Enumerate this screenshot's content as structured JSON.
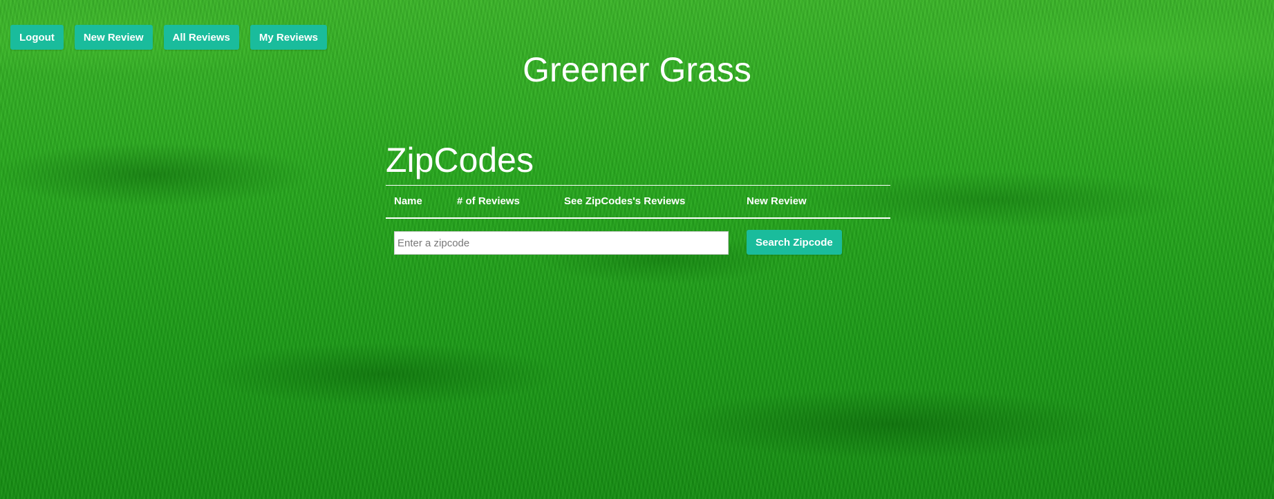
{
  "nav": {
    "items": [
      {
        "label": "Logout"
      },
      {
        "label": "New Review"
      },
      {
        "label": "All Reviews"
      },
      {
        "label": "My Reviews"
      }
    ]
  },
  "header": {
    "title": "Greener Grass"
  },
  "main": {
    "section_title": "ZipCodes",
    "table": {
      "columns": [
        "Name",
        "# of Reviews",
        "See ZipCodes's Reviews",
        "New Review"
      ]
    },
    "search": {
      "value": "",
      "placeholder": "Enter a zipcode",
      "button_label": "Search Zipcode"
    }
  },
  "colors": {
    "accent": "#1abc9c",
    "text": "#ffffff",
    "background": "#22a81e"
  }
}
